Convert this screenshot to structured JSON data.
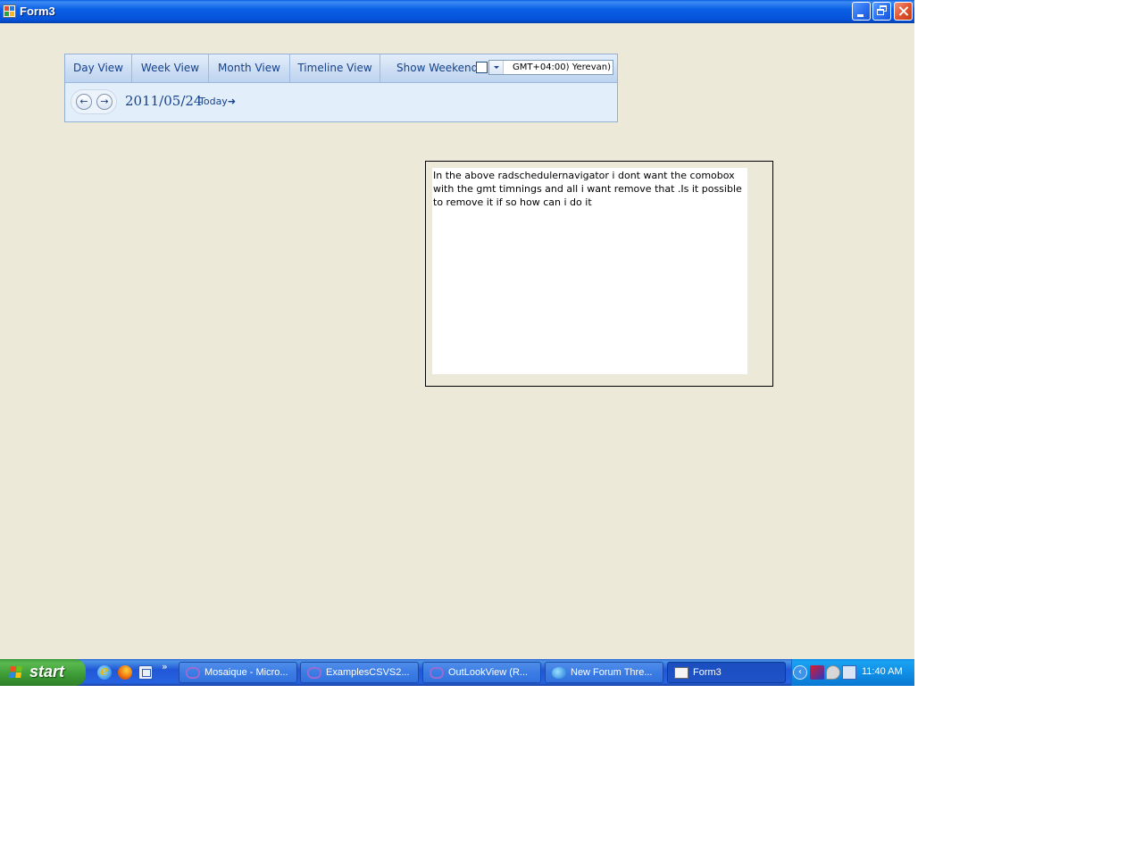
{
  "window": {
    "title": "Form3"
  },
  "navigator": {
    "tabs": [
      {
        "label": "Day View"
      },
      {
        "label": "Week View"
      },
      {
        "label": "Month View"
      },
      {
        "label": "Timeline View"
      }
    ],
    "show_weekend_label": "Show Weekend",
    "show_weekend_checked": false,
    "timezone_value": "GMT+04:00) Yerevan)",
    "date": "2011/05/24",
    "today_label": "Today",
    "prev_arrow": "←",
    "next_arrow": "→",
    "today_arrow": "➜"
  },
  "note": {
    "text": "In the above radschedulernavigator i dont want the comobox with the gmt timnings and all i want remove that .Is it possible to remove it if so how can i do it"
  },
  "taskbar": {
    "start_label": "start",
    "quick_more": "»",
    "tasks": [
      {
        "label": "Mosaique - Micro...",
        "icon": "visual-studio-icon",
        "active": false
      },
      {
        "label": "ExamplesCSVS2...",
        "icon": "visual-studio-icon",
        "active": false
      },
      {
        "label": "OutLookView (R...",
        "icon": "visual-studio-icon",
        "active": false
      },
      {
        "label": "New Forum Thre...",
        "icon": "internet-explorer-icon",
        "active": false
      },
      {
        "label": "Form3",
        "icon": "form-icon",
        "active": true
      }
    ],
    "tray_chevron": "‹",
    "clock": "11:40 AM"
  }
}
